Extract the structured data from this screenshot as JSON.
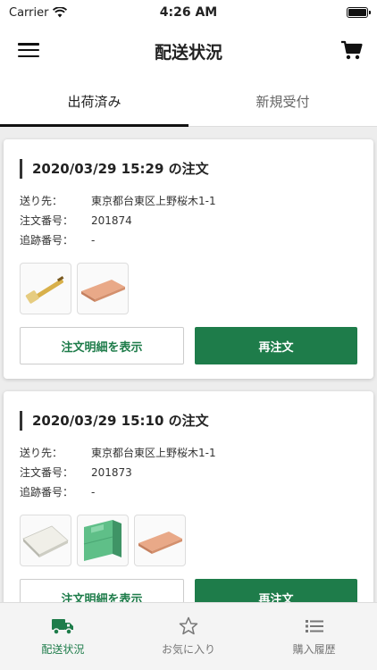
{
  "status_bar": {
    "carrier": "Carrier",
    "time": "4:26 AM"
  },
  "header": {
    "title": "配送状況",
    "menu_icon": "menu-icon",
    "cart_icon": "cart-icon"
  },
  "tabs": [
    {
      "label": "出荷済み",
      "active": true
    },
    {
      "label": "新規受付",
      "active": false
    }
  ],
  "orders": [
    {
      "title": "2020/03/29 15:29 の注文",
      "destination_label": "送り先：",
      "destination": "東京都台東区上野桜木1-1",
      "order_no_label": "注文番号：",
      "order_no": "201874",
      "tracking_label": "追跡番号：",
      "tracking": "-",
      "details_button": "注文明細を表示",
      "reorder_button": "再注文"
    },
    {
      "title": "2020/03/29 15:10 の注文",
      "destination_label": "送り先：",
      "destination": "東京都台東区上野桜木1-1",
      "order_no_label": "注文番号：",
      "order_no": "201873",
      "tracking_label": "追跡番号：",
      "tracking": "-",
      "details_button": "注文明細を表示",
      "reorder_button": "再注文"
    }
  ],
  "bottom_nav": [
    {
      "label": "配送状況",
      "icon": "truck-icon",
      "active": true
    },
    {
      "label": "お気に入り",
      "icon": "star-icon",
      "active": false
    },
    {
      "label": "購入履歴",
      "icon": "list-icon",
      "active": false
    }
  ],
  "colors": {
    "accent": "#1e7c4a",
    "background": "#ededed"
  }
}
